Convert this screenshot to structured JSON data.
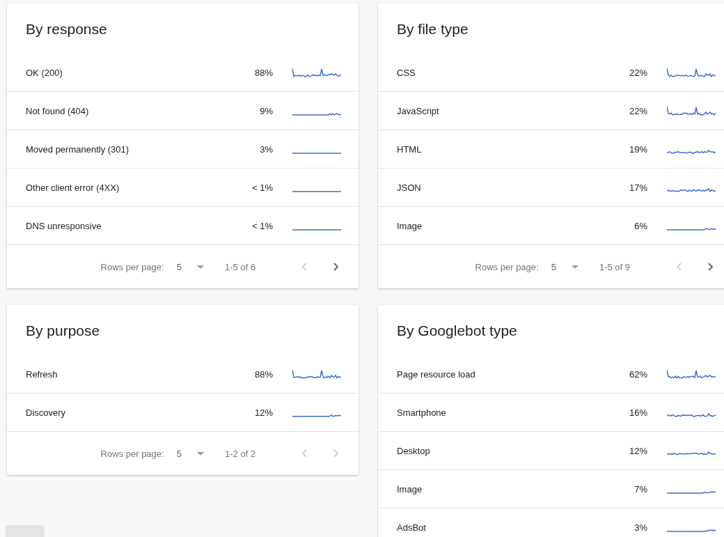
{
  "cards": [
    {
      "title": "By response",
      "rows": [
        {
          "label": "OK (200)",
          "percent": "88%"
        },
        {
          "label": "Not found (404)",
          "percent": "9%"
        },
        {
          "label": "Moved permanently (301)",
          "percent": "3%"
        },
        {
          "label": "Other client error (4XX)",
          "percent": "< 1%"
        },
        {
          "label": "DNS unresponsive",
          "percent": "< 1%"
        }
      ],
      "pagination": {
        "rows_label": "Rows per page:",
        "rows_value": "5",
        "range": "1-5 of 6",
        "prev_disabled": true,
        "next_disabled": false
      }
    },
    {
      "title": "By file type",
      "rows": [
        {
          "label": "CSS",
          "percent": "22%"
        },
        {
          "label": "JavaScript",
          "percent": "22%"
        },
        {
          "label": "HTML",
          "percent": "19%"
        },
        {
          "label": "JSON",
          "percent": "17%"
        },
        {
          "label": "Image",
          "percent": "6%"
        }
      ],
      "pagination": {
        "rows_label": "Rows per page:",
        "rows_value": "5",
        "range": "1-5 of 9",
        "prev_disabled": true,
        "next_disabled": false
      }
    },
    {
      "title": "By purpose",
      "rows": [
        {
          "label": "Refresh",
          "percent": "88%"
        },
        {
          "label": "Discovery",
          "percent": "12%"
        }
      ],
      "pagination": {
        "rows_label": "Rows per page:",
        "rows_value": "5",
        "range": "1-2 of 2",
        "prev_disabled": true,
        "next_disabled": true
      }
    },
    {
      "title": "By Googlebot type",
      "rows": [
        {
          "label": "Page resource load",
          "percent": "62%"
        },
        {
          "label": "Smartphone",
          "percent": "16%"
        },
        {
          "label": "Desktop",
          "percent": "12%"
        },
        {
          "label": "Image",
          "percent": "7%"
        },
        {
          "label": "AdsBot",
          "percent": "3%"
        }
      ]
    }
  ]
}
